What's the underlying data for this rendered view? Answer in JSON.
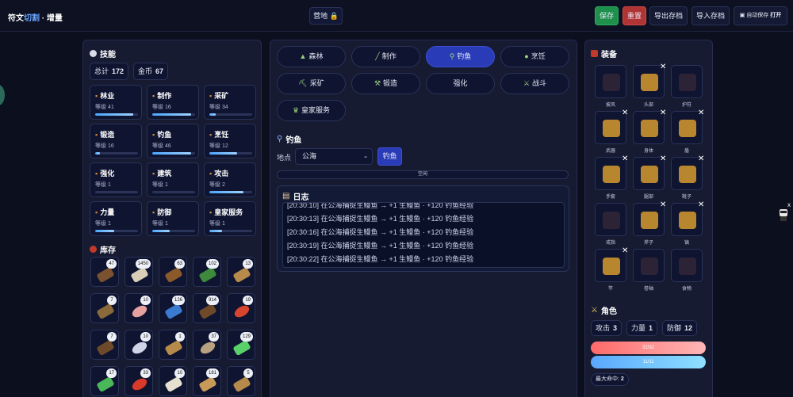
{
  "header": {
    "brand_a": "符文",
    "brand_b": "切割",
    "brand_c": " · 增量",
    "camp": "营地",
    "save": "保存",
    "reset": "重置",
    "export": "导出存档",
    "import": "导入存档",
    "auto_save": "自动保存",
    "auto_state": "打开"
  },
  "skills": {
    "title": "技能",
    "total_label": "总计",
    "total": "172",
    "gold_label": "金币",
    "gold": "67",
    "items": [
      {
        "name": "林业",
        "level": "等级 41",
        "progress": 0.88
      },
      {
        "name": "制作",
        "level": "等级 16",
        "progress": 0.9
      },
      {
        "name": "采矿",
        "level": "等级 34",
        "progress": 0.15
      },
      {
        "name": "锻造",
        "level": "等级 16",
        "progress": 0.12
      },
      {
        "name": "钓鱼",
        "level": "等级 46",
        "progress": 0.9
      },
      {
        "name": "烹饪",
        "level": "等级 12",
        "progress": 0.65
      },
      {
        "name": "强化",
        "level": "等级 1",
        "progress": 0
      },
      {
        "name": "建筑",
        "level": "等级 1",
        "progress": 0
      },
      {
        "name": "攻击",
        "level": "等级 2",
        "progress": 0.8
      },
      {
        "name": "力量",
        "level": "等级 1",
        "progress": 0.45
      },
      {
        "name": "防御",
        "level": "等级 1",
        "progress": 0.4
      },
      {
        "name": "皇家服务",
        "level": "等级 1",
        "progress": 0.3
      }
    ]
  },
  "inventory": {
    "title": "库存",
    "items": [
      {
        "count": "47",
        "icon": "log-icon",
        "color": "#7a5230"
      },
      {
        "count": "1450",
        "icon": "sail-icon",
        "color": "#d9cfb8"
      },
      {
        "count": "63",
        "icon": "wood-barrel-icon",
        "color": "#8a5a2b"
      },
      {
        "count": "102",
        "icon": "herb-icon",
        "color": "#3d8a3d"
      },
      {
        "count": "13",
        "icon": "plank-icon",
        "color": "#b58a4a"
      },
      {
        "count": "7",
        "icon": "knife-icon",
        "color": "#8a6a3a"
      },
      {
        "count": "10",
        "icon": "shrimp-icon",
        "color": "#e7a0a0"
      },
      {
        "count": "126",
        "icon": "water-icon",
        "color": "#3a7ad0"
      },
      {
        "count": "914",
        "icon": "log-icon",
        "color": "#6e4a2a"
      },
      {
        "count": "19",
        "icon": "shrimp-red-icon",
        "color": "#d8452e"
      },
      {
        "count": "7",
        "icon": "logs-icon",
        "color": "#6e4a2a"
      },
      {
        "count": "10",
        "icon": "fish-icon",
        "color": "#cfd5e6"
      },
      {
        "count": "1",
        "icon": "hammer-icon",
        "color": "#b58a4a"
      },
      {
        "count": "37",
        "icon": "fish-brown-icon",
        "color": "#b8a080"
      },
      {
        "count": "129",
        "icon": "eel-icon",
        "color": "#5ad06a"
      },
      {
        "count": "17",
        "icon": "eel-icon",
        "color": "#4ab85a"
      },
      {
        "count": "33",
        "icon": "ore-red-icon",
        "color": "#d83a2a"
      },
      {
        "count": "10",
        "icon": "salt-pile-icon",
        "color": "#e6e0d0"
      },
      {
        "count": "181",
        "icon": "nugget-icon",
        "color": "#c89a5a"
      },
      {
        "count": "5",
        "icon": "plank-icon",
        "color": "#b58a4a"
      }
    ]
  },
  "tabs": [
    {
      "label": "森林",
      "active": false
    },
    {
      "label": "制作",
      "active": false
    },
    {
      "label": "钓鱼",
      "active": true
    },
    {
      "label": "烹饪",
      "active": false
    },
    {
      "label": "采矿",
      "active": false
    },
    {
      "label": "锻造",
      "active": false
    },
    {
      "label": "强化",
      "active": false
    },
    {
      "label": "战斗",
      "active": false
    },
    {
      "label": "皇家服务",
      "active": false
    }
  ],
  "fishing": {
    "title": "钓鱼",
    "location_label": "地点",
    "location_value": "公海",
    "action_button": "钓鱼",
    "status": "空闲"
  },
  "log": {
    "title": "日志",
    "lines": [
      "[20:30:10] 在公海捕捉生鳗鱼 → +1 生鳗鱼 · +120 钓鱼经验",
      "[20:30:13] 在公海捕捉生鳗鱼 → +1 生鳗鱼 · +120 钓鱼经验",
      "[20:30:16] 在公海捕捉生鳗鱼 → +1 生鳗鱼 · +120 钓鱼经验",
      "[20:30:19] 在公海捕捉生鳗鱼 → +1 生鳗鱼 · +120 钓鱼经验",
      "[20:30:22] 在公海捕捉生鳗鱼 → +1 生鳗鱼 · +120 钓鱼经验"
    ]
  },
  "equipment": {
    "title": "装备",
    "slots": [
      {
        "label": "披风",
        "icon": "cape-icon",
        "filled": false
      },
      {
        "label": "头部",
        "icon": "helmet-icon",
        "filled": true
      },
      {
        "label": "护符",
        "icon": "amulet-icon",
        "filled": false
      },
      {
        "label": "武器",
        "icon": "sword-icon",
        "filled": true
      },
      {
        "label": "身体",
        "icon": "chestplate-icon",
        "filled": true
      },
      {
        "label": "盾",
        "icon": "shield-icon",
        "filled": true
      },
      {
        "label": "手套",
        "icon": "gloves-icon",
        "filled": true
      },
      {
        "label": "腿部",
        "icon": "legs-icon",
        "filled": true
      },
      {
        "label": "靴子",
        "icon": "boots-icon",
        "filled": true
      },
      {
        "label": "戒指",
        "icon": "ring-icon",
        "filled": false
      },
      {
        "label": "斧子",
        "icon": "axe-icon",
        "filled": true
      },
      {
        "label": "镐",
        "icon": "pickaxe-icon",
        "filled": true
      },
      {
        "label": "竿",
        "icon": "rod-icon",
        "filled": true
      },
      {
        "label": "卷轴",
        "icon": "scroll-icon",
        "filled": false
      },
      {
        "label": "食物",
        "icon": "food-icon",
        "filled": false
      }
    ]
  },
  "character": {
    "title": "角色",
    "attack_label": "攻击",
    "attack": "3",
    "strength_label": "力量",
    "strength": "1",
    "defense_label": "防御",
    "defense": "12",
    "hp": "32/32",
    "mp": "11/11",
    "max_hit_label": "最大命中:",
    "max_hit": "2"
  }
}
